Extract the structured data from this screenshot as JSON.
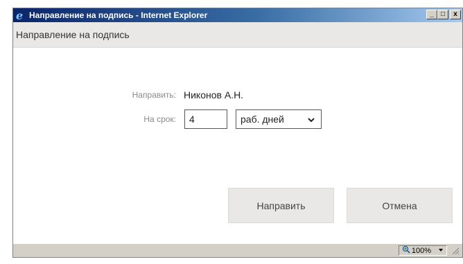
{
  "window": {
    "title": "Направление на подпись - Internet Explorer",
    "controls": {
      "minimize": "_",
      "maximize": "□",
      "close": "x"
    }
  },
  "dialog": {
    "title": "Направление на подпись"
  },
  "form": {
    "recipient_label": "Направить:",
    "recipient_value": "Никонов А.Н.",
    "term_label": "На срок:",
    "term_value": "4",
    "term_unit": "раб. дней"
  },
  "buttons": {
    "submit": "Направить",
    "cancel": "Отмена"
  },
  "statusbar": {
    "zoom": "100%"
  },
  "icons": {
    "browser": "internet-explorer-icon",
    "select_arrow": "chevron-down-icon",
    "zoom": "zoom-magnifier-icon",
    "zoom_menu": "caret-down-icon",
    "resize": "resize-grip-icon"
  }
}
